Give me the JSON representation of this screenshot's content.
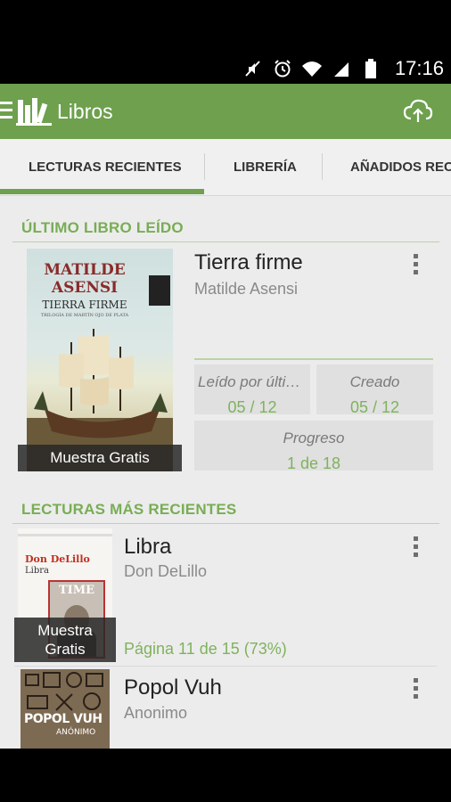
{
  "status_bar": {
    "time": "17:16",
    "icons": [
      "mute-icon",
      "alarm-icon",
      "wifi-icon",
      "signal-icon",
      "battery-icon"
    ]
  },
  "app_bar": {
    "title": "Libros",
    "menu_icon": "hamburger-icon",
    "logo_icon": "library-logo-icon",
    "action_icon": "cloud-sync-icon"
  },
  "tabs": [
    {
      "label": "LECTURAS RECIENTES",
      "selected": true
    },
    {
      "label": "LIBRERÍA",
      "selected": false
    },
    {
      "label": "AÑADIDOS RECIENTEMENTE",
      "selected": false
    }
  ],
  "last_read": {
    "header": "ÚLTIMO LIBRO LEÍDO",
    "book": {
      "title": "Tierra firme",
      "author": "Matilde Asensi",
      "sample_label": "Muestra Gratis",
      "cover": {
        "author_line1": "MATILDE",
        "author_line2": "ASENSI",
        "title": "TIERRA FIRME",
        "subtitle": "TRILOGÍA DE MARTÍN OJO DE PLATA"
      }
    },
    "stats": {
      "last_read_label": "Leído por últim...",
      "last_read_value": "05 / 12",
      "created_label": "Creado",
      "created_value": "05 / 12",
      "progress_label": "Progreso",
      "progress_value": "1 de 18"
    }
  },
  "recent": {
    "header": "LECTURAS MÁS RECIENTES",
    "items": [
      {
        "title": "Libra",
        "author": "Don DeLillo",
        "progress": "Página 11 de 15 (73%)",
        "sample_label_line1": "Muestra",
        "sample_label_line2": "Gratis",
        "cover": {
          "author": "Don DeLillo",
          "title": "Libra",
          "magazine": "TIME"
        }
      },
      {
        "title": "Popol Vuh",
        "author": "Anonimo",
        "cover": {
          "title": "POPOL VUH",
          "author": "ANÓNIMO"
        }
      }
    ]
  },
  "colors": {
    "accent": "#6ea04e",
    "accent_text": "#79ad55",
    "background": "#ececec"
  }
}
